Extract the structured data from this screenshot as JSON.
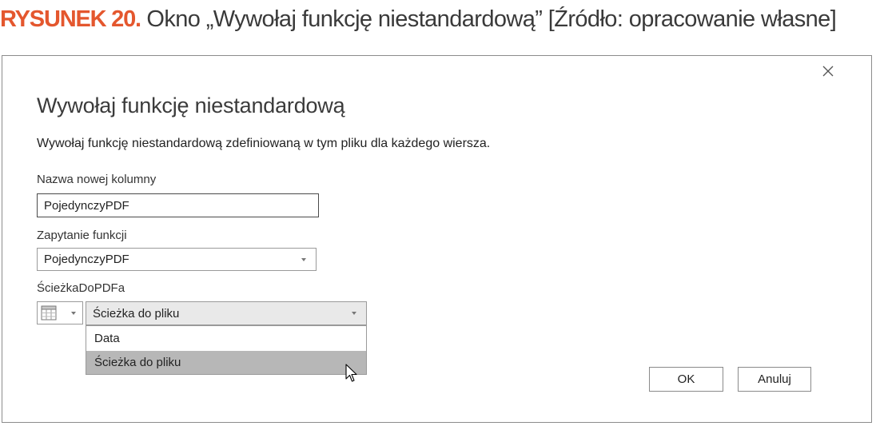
{
  "caption": {
    "label": "RYSUNEK 20.",
    "text": " Okno „Wywołaj funkcję niestandardową” [Źródło: opracowanie własne]"
  },
  "dialog": {
    "title": "Wywołaj funkcję niestandardową",
    "description": "Wywołaj funkcję niestandardową zdefiniowaną w tym pliku dla każdego wiersza.",
    "new_column": {
      "label": "Nazwa nowej kolumny",
      "value": "PojedynczyPDF"
    },
    "function_query": {
      "label": "Zapytanie funkcji",
      "selected": "PojedynczyPDF"
    },
    "parameter": {
      "label": "ŚcieżkaDoPDFa",
      "selected": "Ścieżka do pliku",
      "options": [
        "Data",
        "Ścieżka do pliku"
      ],
      "hovered_option": "Ścieżka do pliku"
    },
    "ok_label": "OK",
    "cancel_label": "Anuluj"
  },
  "icons": {
    "close": "close-icon",
    "column_type": "table-icon",
    "dropdown": "chevron-down-icon",
    "pointer": "mouse-cursor-icon"
  },
  "colors": {
    "caption_accent": "#e4572e",
    "hover_background": "#b7b7b7"
  }
}
